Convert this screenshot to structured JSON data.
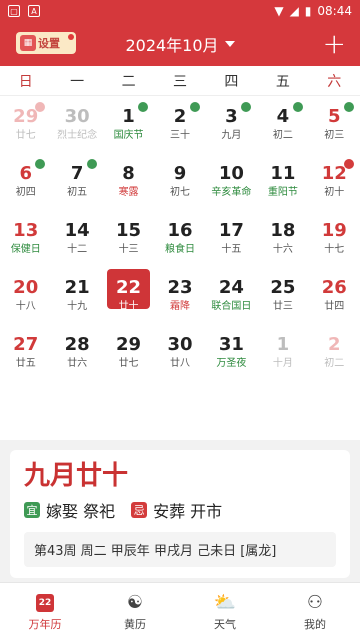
{
  "status": {
    "time": "08:44"
  },
  "header": {
    "settings_label": "设置",
    "month_title": "2024年10月",
    "plus_symbol": "+"
  },
  "weekdays": [
    "日",
    "一",
    "二",
    "三",
    "四",
    "五",
    "六"
  ],
  "days": [
    {
      "num": "29",
      "sub": "廿七",
      "other": true,
      "weekend": true,
      "tag": "rest-faded"
    },
    {
      "num": "30",
      "sub": "烈士纪念",
      "other": true
    },
    {
      "num": "1",
      "sub": "国庆节",
      "festival": true,
      "tag": "rest"
    },
    {
      "num": "2",
      "sub": "三十",
      "tag": "rest"
    },
    {
      "num": "3",
      "sub": "九月",
      "tag": "rest"
    },
    {
      "num": "4",
      "sub": "初二",
      "tag": "rest"
    },
    {
      "num": "5",
      "sub": "初三",
      "weekend": true,
      "tag": "rest"
    },
    {
      "num": "6",
      "sub": "初四",
      "weekend": true,
      "tag": "rest"
    },
    {
      "num": "7",
      "sub": "初五",
      "tag": "rest"
    },
    {
      "num": "8",
      "sub": "寒露",
      "solar": true
    },
    {
      "num": "9",
      "sub": "初七"
    },
    {
      "num": "10",
      "sub": "辛亥革命",
      "festival": true
    },
    {
      "num": "11",
      "sub": "重阳节",
      "festival": true
    },
    {
      "num": "12",
      "sub": "初十",
      "weekend": true,
      "tag": "work"
    },
    {
      "num": "13",
      "sub": "保健日",
      "weekend": true,
      "festival": true
    },
    {
      "num": "14",
      "sub": "十二"
    },
    {
      "num": "15",
      "sub": "十三"
    },
    {
      "num": "16",
      "sub": "粮食日",
      "festival": true
    },
    {
      "num": "17",
      "sub": "十五"
    },
    {
      "num": "18",
      "sub": "十六"
    },
    {
      "num": "19",
      "sub": "十七",
      "weekend": true
    },
    {
      "num": "20",
      "sub": "十八",
      "weekend": true
    },
    {
      "num": "21",
      "sub": "十九"
    },
    {
      "num": "22",
      "sub": "廿十",
      "today": true
    },
    {
      "num": "23",
      "sub": "霜降",
      "solar": true
    },
    {
      "num": "24",
      "sub": "联合国日",
      "festival": true
    },
    {
      "num": "25",
      "sub": "廿三"
    },
    {
      "num": "26",
      "sub": "廿四",
      "weekend": true
    },
    {
      "num": "27",
      "sub": "廿五",
      "weekend": true
    },
    {
      "num": "28",
      "sub": "廿六"
    },
    {
      "num": "29",
      "sub": "廿七"
    },
    {
      "num": "30",
      "sub": "廿八"
    },
    {
      "num": "31",
      "sub": "万圣夜",
      "festival": true
    },
    {
      "num": "1",
      "sub": "十月",
      "other": true
    },
    {
      "num": "2",
      "sub": "初二",
      "other": true,
      "weekend": true
    }
  ],
  "info": {
    "lunar_date": "九月廿十",
    "yi_char": "宜",
    "yi_text": "嫁娶 祭祀",
    "ji_char": "忌",
    "ji_text": "安葬 开市",
    "ganzhi": "第43周 周二  甲辰年 甲戌月 己未日 [属龙]"
  },
  "nav": [
    {
      "label": "万年历",
      "icon": "calendar-icon",
      "active": true,
      "badge": "22"
    },
    {
      "label": "黄历",
      "icon": "yin-yang-icon"
    },
    {
      "label": "天气",
      "icon": "weather-icon"
    },
    {
      "label": "我的",
      "icon": "profile-icon"
    }
  ]
}
